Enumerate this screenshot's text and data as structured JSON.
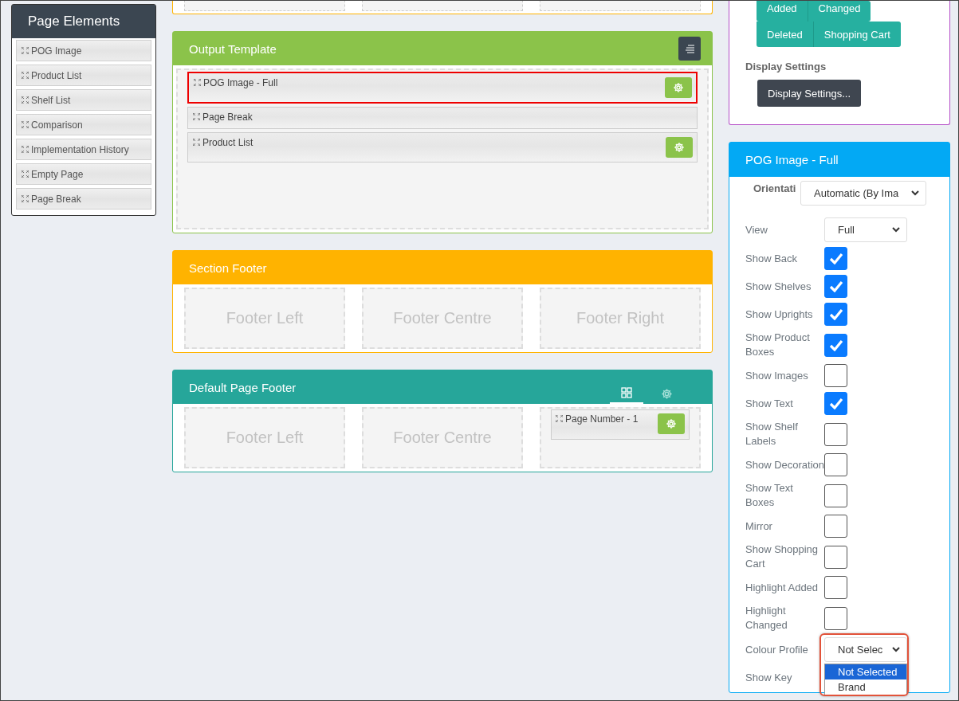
{
  "palette": {
    "title": "Page Elements",
    "items": [
      "POG Image",
      "Product List",
      "Shelf List",
      "Comparison",
      "Implementation History",
      "Empty Page",
      "Page Break"
    ]
  },
  "template": {
    "title": "Output Template",
    "color": "#8bc34a",
    "items": [
      {
        "label": "POG Image - Full",
        "selected": true,
        "settings": true
      },
      {
        "label": "Page Break",
        "selected": false,
        "settings": false
      },
      {
        "label": "Product List",
        "selected": false,
        "settings": true
      }
    ]
  },
  "footers": [
    {
      "title": "Section Footer",
      "color": "#ffb300",
      "slots": [
        {
          "label": "Footer Left"
        },
        {
          "label": "Footer Centre"
        },
        {
          "label": "Footer Right"
        }
      ]
    },
    {
      "title": "Default Page Footer",
      "color": "#26a69a",
      "tabs": [
        {
          "kind": "grid",
          "selected": true
        },
        {
          "kind": "gear",
          "selected": false
        }
      ],
      "slots": [
        {
          "label": "Footer Left"
        },
        {
          "label": "Footer Centre"
        },
        {
          "widget": "Page Number - 1"
        }
      ]
    }
  ],
  "legend": {
    "rows": [
      [
        "Added",
        "Changed"
      ],
      [
        "Deleted",
        "Shopping Cart"
      ]
    ],
    "heading": "Display Settings",
    "button": "Display Settings..."
  },
  "properties": {
    "title": "POG Image - Full",
    "orientation": {
      "label": "Orientati",
      "value": "Automatic (By Ima"
    },
    "fields": [
      {
        "kind": "select",
        "label": "View",
        "value": "Full"
      },
      {
        "kind": "checkbox",
        "label": "Show Back",
        "checked": true
      },
      {
        "kind": "checkbox",
        "label": "Show Shelves",
        "checked": true
      },
      {
        "kind": "checkbox",
        "label": "Show Uprights",
        "checked": true
      },
      {
        "kind": "checkbox",
        "label": "Show Product Boxes",
        "checked": true
      },
      {
        "kind": "checkbox",
        "label": "Show Images",
        "checked": false
      },
      {
        "kind": "checkbox",
        "label": "Show Text",
        "checked": true
      },
      {
        "kind": "checkbox",
        "label": "Show Shelf Labels",
        "checked": false
      },
      {
        "kind": "checkbox",
        "label": "Show Decoration",
        "checked": false
      },
      {
        "kind": "checkbox",
        "label": "Show Text Boxes",
        "checked": false
      },
      {
        "kind": "checkbox",
        "label": "Mirror",
        "checked": false
      },
      {
        "kind": "checkbox",
        "label": "Show Shopping Cart",
        "checked": false
      },
      {
        "kind": "checkbox",
        "label": "Highlight Added",
        "checked": false
      },
      {
        "kind": "checkbox",
        "label": "Highlight Changed",
        "checked": false
      },
      {
        "kind": "select",
        "label": "Colour Profile",
        "value": "Not Selec",
        "open": true,
        "options": [
          {
            "label": "Not Selected",
            "selected": true
          },
          {
            "label": "Brand",
            "selected": false
          }
        ]
      },
      {
        "kind": "label",
        "label": "Show Key"
      }
    ]
  }
}
